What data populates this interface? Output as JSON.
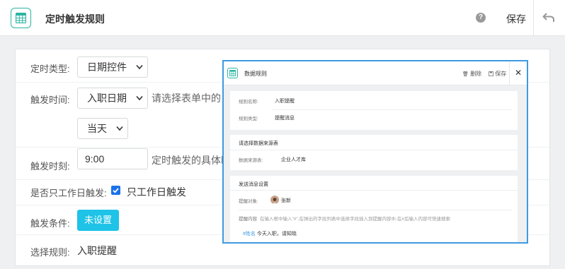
{
  "header": {
    "title": "定时触发规则",
    "help_icon_text": "?",
    "save_label": "保存"
  },
  "form": {
    "timer_type": {
      "label": "定时类型:",
      "value": "日期控件"
    },
    "trigger_time": {
      "label": "触发时间:",
      "field_value": "入职日期",
      "hint": "请选择表单中的日",
      "day_value": "当天"
    },
    "trigger_moment": {
      "label": "触发时刻:",
      "value": "9:00",
      "hint": "定时触发的具体时"
    },
    "workday_only": {
      "label": "是否只工作日触发:",
      "checkbox_label": "只工作日触发",
      "checked": true
    },
    "condition": {
      "label": "触发条件:",
      "button_label": "未设置"
    },
    "rule": {
      "label": "选择规则:",
      "value": "入职提醒"
    }
  },
  "popup": {
    "title": "数据规则",
    "delete_label": "删除",
    "save_label": "保存",
    "close_glyph": "✕",
    "rule_name_label": "规则名称:",
    "rule_name_value": "入职提醒",
    "rule_type_label": "规则类型:",
    "rule_type_value": "提醒消息",
    "datasource_title": "请选择数据来源表",
    "datasource_label": "数据来源表:",
    "datasource_value": "企业人才库",
    "message_title": "发送消息设置",
    "recipient_label": "提醒对象:",
    "recipient_value": "张新",
    "content_label": "提醒内容",
    "content_hint": "在输入框中输入\"#\",在弹出的字段列表中选择字段插入到提醒内容中,在#后输入内容可快速搜索",
    "content_field_tag": "#姓名",
    "content_text": "今天入职，请知晓"
  },
  "colors": {
    "accent_teal": "#2bb5a3",
    "accent_cyan": "#1ec3e7",
    "popup_border": "#3e9ae0",
    "checkbox_blue": "#1a73e8",
    "field_tag": "#3e9ae0"
  },
  "icons": {
    "app": "table-grid-icon",
    "help": "question-circle-icon",
    "back": "undo-arrow-icon",
    "delete": "trash-icon",
    "save": "floppy-icon",
    "close": "close-icon",
    "avatar": "user-avatar"
  }
}
